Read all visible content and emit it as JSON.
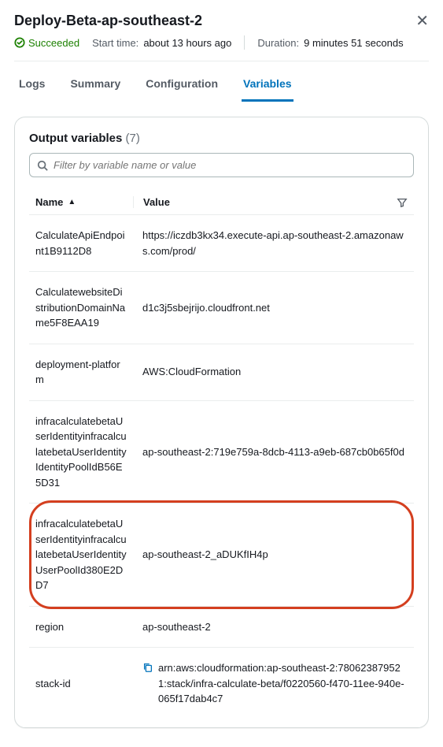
{
  "header": {
    "title": "Deploy-Beta-ap-southeast-2",
    "status": "Succeeded",
    "start_label": "Start time:",
    "start_value": "about 13 hours ago",
    "duration_label": "Duration:",
    "duration_value": "9 minutes 51 seconds"
  },
  "tabs": {
    "logs": "Logs",
    "summary": "Summary",
    "configuration": "Configuration",
    "variables": "Variables"
  },
  "card": {
    "title": "Output variables",
    "count": "(7)",
    "search_placeholder": "Filter by variable name or value"
  },
  "columns": {
    "name": "Name",
    "value": "Value"
  },
  "rows": [
    {
      "name": "CalculateApiEndpoint1B9112D8",
      "value": "https://iczdb3kx34.execute-api.ap-southeast-2.amazonaws.com/prod/",
      "copy": false
    },
    {
      "name": "CalculatewebsiteDistributionDomainName5F8EAA19",
      "value": "d1c3j5sbejrijo.cloudfront.net",
      "copy": false
    },
    {
      "name": "deployment-platform",
      "value": "AWS:CloudFormation",
      "copy": false
    },
    {
      "name": "infracalculatebetaUserIdentityinfracalculatebetaUserIdentityIdentityPoolIdB56E5D31",
      "value": "ap-southeast-2:719e759a-8dcb-4113-a9eb-687cb0b65f0d",
      "copy": false
    },
    {
      "name": "infracalculatebetaUserIdentityinfracalculatebetaUserIdentityUserPoolId380E2DD7",
      "value": "ap-southeast-2_aDUKfIH4p",
      "copy": false,
      "highlighted": true
    },
    {
      "name": "region",
      "value": "ap-southeast-2",
      "copy": false
    },
    {
      "name": "stack-id",
      "value": "arn:aws:cloudformation:ap-southeast-2:780623879521:stack/infra-calculate-beta/f0220560-f470-11ee-940e-065f17dab4c7",
      "copy": true
    }
  ]
}
